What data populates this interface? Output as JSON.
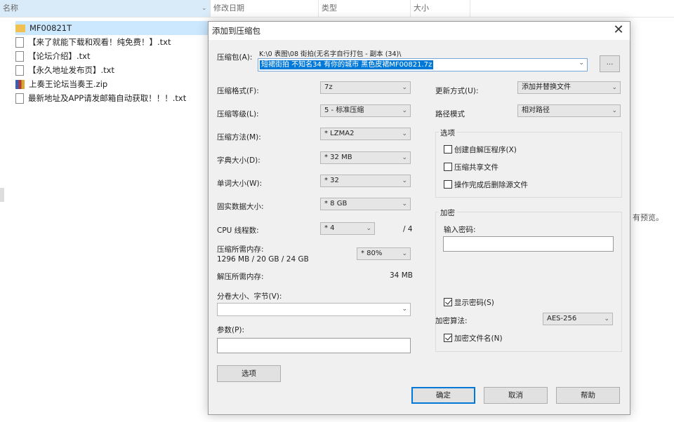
{
  "explorer": {
    "columns": [
      {
        "label": "名称",
        "chevron": "⌄"
      },
      {
        "label": "修改日期"
      },
      {
        "label": "类型"
      },
      {
        "label": "大小"
      }
    ],
    "files": [
      {
        "name": "MF00821T",
        "type": "folder"
      },
      {
        "name": "【来了就能下载和观看！纯免费！】.txt",
        "type": "txt"
      },
      {
        "name": "【论坛介绍】.txt",
        "type": "txt"
      },
      {
        "name": "【永久地址发布页】.txt",
        "type": "txt"
      },
      {
        "name": "上奏王论坛当奏王.zip",
        "type": "zip"
      },
      {
        "name": "最新地址及APP请发邮箱自动获取！！！.txt",
        "type": "txt"
      }
    ],
    "right_text": "有预览。"
  },
  "dialog": {
    "title": "添加到压缩包",
    "close": "✕",
    "archive_label": "压缩包(A):",
    "archive_path": "K:\\0 表图\\08 街拍(无名字自行打包 - 副本 (34)\\",
    "archive_name": "短裙街拍 不知名34 有你的城市 黑色皮裙MF00821.7z",
    "browse_label": "...",
    "format_label": "压缩格式(F):",
    "format_value": "7z",
    "level_label": "压缩等级(L):",
    "level_value": "5 - 标准压缩",
    "method_label": "压缩方法(M):",
    "method_value": "* LZMA2",
    "dict_label": "字典大小(D):",
    "dict_value": "* 32 MB",
    "word_label": "单词大小(W):",
    "word_value": "* 32",
    "solid_label": "固实数据大小:",
    "solid_value": "* 8 GB",
    "cpu_label": "CPU 线程数:",
    "cpu_value": "* 4",
    "cpu_total": "/ 4",
    "mem_label": "压缩所需内存:",
    "mem_detail": "1296 MB / 20 GB / 24 GB",
    "mem_value": "* 80%",
    "decomp_label": "解压所需内存:",
    "decomp_value": "34 MB",
    "split_label": "分卷大小、字节(V):",
    "params_label": "参数(P):",
    "options_btn": "选项",
    "update_label": "更新方式(U):",
    "update_value": "添加并替换文件",
    "path_label": "路径模式",
    "path_value": "相对路径",
    "options_group": "选项",
    "opt_sfx": "创建自解压程序(X)",
    "opt_shared": "压缩共享文件",
    "opt_delete": "操作完成后删除源文件",
    "encrypt_group": "加密",
    "password_label": "输入密码:",
    "show_password": "显示密码(S)",
    "encrypt_method_label": "加密算法:",
    "encrypt_method_value": "AES-256",
    "encrypt_names": "加密文件名(N)",
    "ok": "确定",
    "cancel": "取消",
    "help": "帮助",
    "arrow": "⌄"
  }
}
